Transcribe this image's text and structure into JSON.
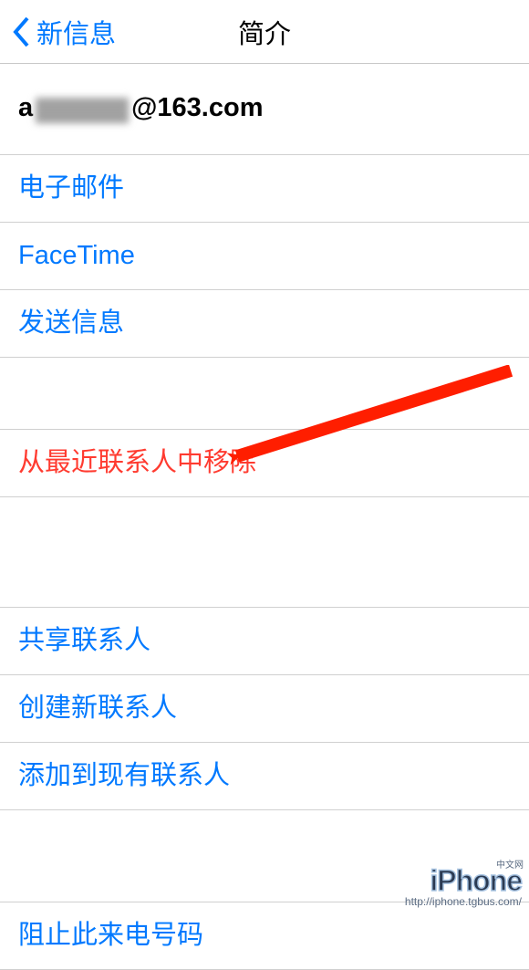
{
  "navbar": {
    "back_label": "新信息",
    "title": "简介"
  },
  "contact": {
    "email_prefix": "a",
    "email_suffix": "@163.com"
  },
  "actions_group1": {
    "email": "电子邮件",
    "facetime": "FaceTime",
    "send_message": "发送信息"
  },
  "actions_group2": {
    "remove_recent": "从最近联系人中移除"
  },
  "actions_group3": {
    "share_contact": "共享联系人",
    "create_contact": "创建新联系人",
    "add_to_existing": "添加到现有联系人"
  },
  "actions_group4": {
    "block": "阻止此来电号码"
  },
  "annotation": {
    "arrow_color": "#ff1e00"
  },
  "watermark": {
    "logo": "iPhone",
    "sub": "中文网",
    "url": "http://iphone.tgbus.com/"
  }
}
